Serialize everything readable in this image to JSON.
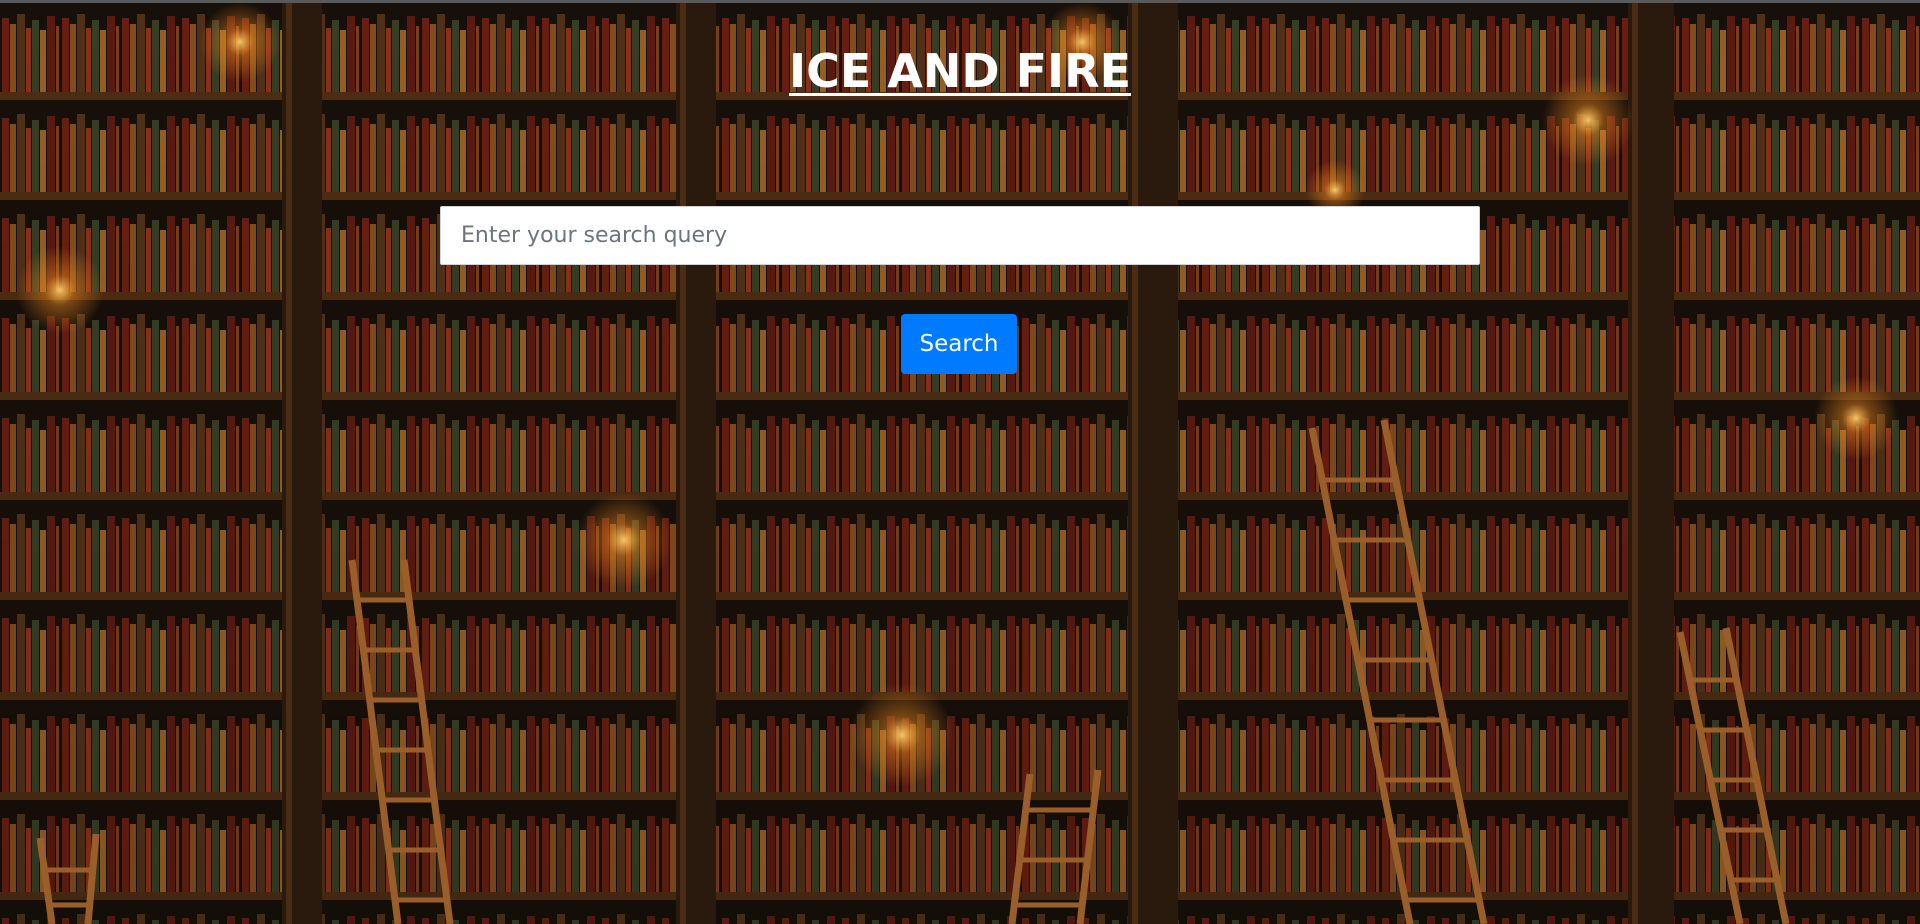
{
  "app": {
    "title": "ICE AND FIRE"
  },
  "search": {
    "placeholder": "Enter your search query",
    "value": "",
    "button_label": "Search"
  },
  "theme": {
    "button_color": "#007bff",
    "title_color": "#ffffff",
    "background": "library-bookshelves-with-candles"
  }
}
